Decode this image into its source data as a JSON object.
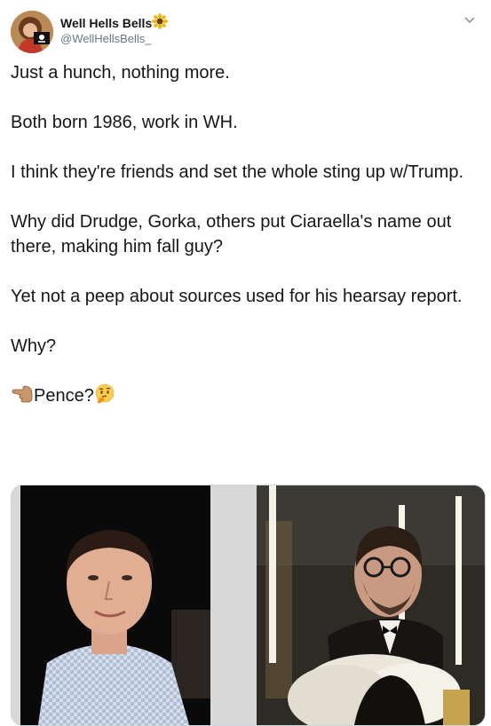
{
  "author": {
    "display_name": "Well Hells Bells",
    "handle": "@WellHellsBells_",
    "badge_icon": "sunflower-emoji"
  },
  "tweet": {
    "paragraphs": [
      "Just a hunch, nothing more.",
      "Both born 1986, work in WH.",
      "I think they're friends and set the whole sting up w/Trump.",
      "Why did Drudge, Gorka, others put Ciaraella's name out there, making him fall guy?",
      "Yet not a peep about sources used for his hearsay report.",
      "Why?"
    ],
    "last_line": {
      "before_icon": "backhand-index-pointing-left-emoji",
      "text": "Pence?",
      "after_icon": "thinking-face-emoji"
    }
  },
  "media": {
    "images": [
      {
        "name": "photo-young-man-checked-shirt"
      },
      {
        "name": "photo-man-glasses-candles"
      }
    ]
  },
  "colors": {
    "text": "#14171a",
    "secondary_text": "#657786",
    "border": "#ccd6dd"
  }
}
